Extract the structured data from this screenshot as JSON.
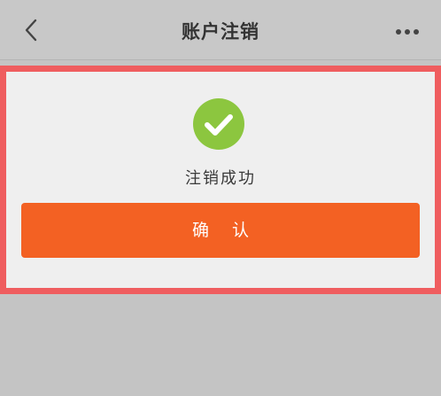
{
  "header": {
    "title": "账户注销",
    "back_icon": "chevron-left-icon",
    "more_icon": "more-dots-icon"
  },
  "dialog": {
    "status_icon": "check-circle-icon",
    "message": "注销成功",
    "confirm_label": "确 认"
  },
  "colors": {
    "accent": "#f36123",
    "success": "#8cc63f",
    "highlight_border": "#ef5d5f"
  }
}
